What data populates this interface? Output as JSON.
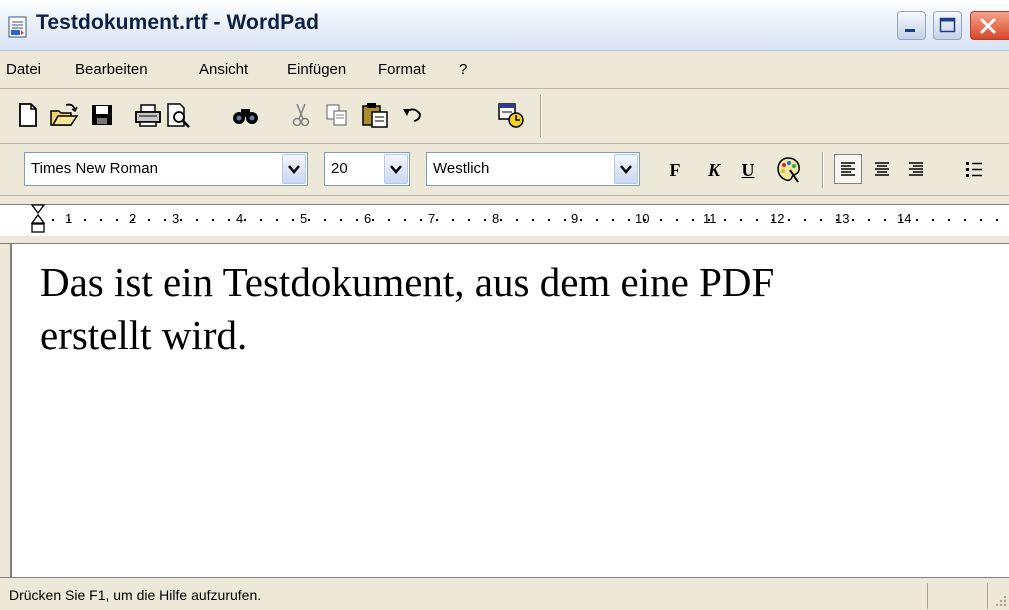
{
  "window": {
    "title": "Testdokument.rtf - WordPad"
  },
  "menu": [
    "Datei",
    "Bearbeiten",
    "Ansicht",
    "Einfügen",
    "Format",
    "?"
  ],
  "toolbar": {
    "buttons": [
      "new-document-icon",
      "open-folder-icon",
      "save-icon",
      "print-icon",
      "print-preview-icon",
      "find-icon",
      "cut-icon",
      "copy-icon",
      "paste-icon",
      "undo-icon",
      "date-time-icon"
    ]
  },
  "format": {
    "font_name": "Times New Roman",
    "font_size": "20",
    "script": "Westlich",
    "bold_label": "F",
    "italic_label": "K",
    "underline_label": "U"
  },
  "ruler": {
    "numbers": [
      "1",
      "2",
      "3",
      "4",
      "5",
      "6",
      "7",
      "8",
      "9",
      "10",
      "11",
      "12",
      "13",
      "14"
    ]
  },
  "document": {
    "lines": [
      "Das ist ein Testdokument, aus dem eine PDF",
      "erstellt wird."
    ]
  },
  "status": {
    "text": "Drücken Sie F1, um die Hilfe aufzurufen."
  },
  "colors": {
    "title_text": "#0c1f44",
    "close_button": "#d8472a",
    "chrome": "#ece9d8"
  }
}
